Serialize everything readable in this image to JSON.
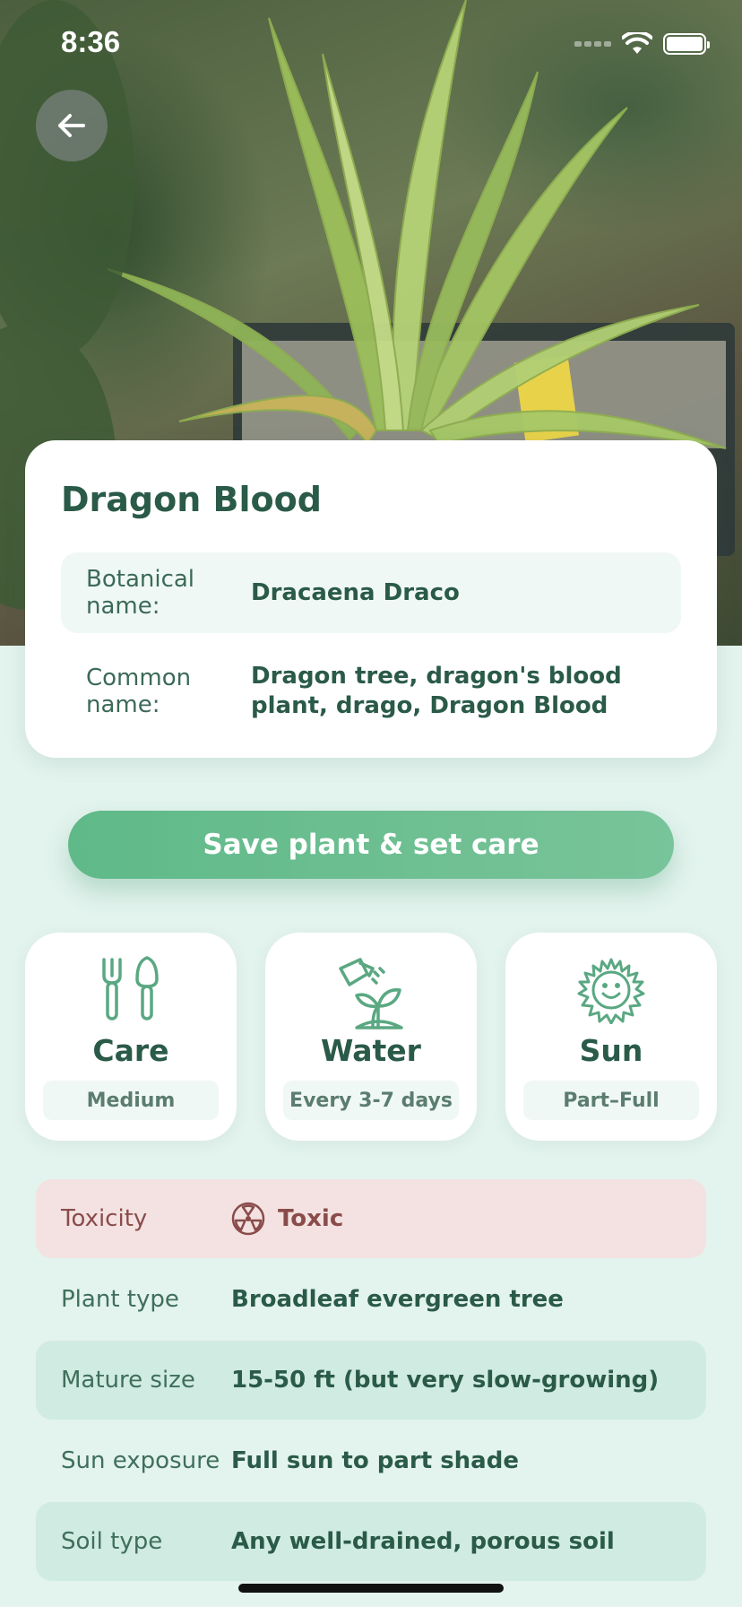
{
  "status_bar": {
    "time": "8:36"
  },
  "plant": {
    "title": "Dragon Blood",
    "botanical_label": "Botanical name:",
    "botanical_value": "Dracaena Draco",
    "common_label": "Common name:",
    "common_value": "Dragon tree, dragon's blood plant, drago, Dragon Blood"
  },
  "actions": {
    "save_label": "Save plant & set care"
  },
  "care_cards": [
    {
      "title": "Care",
      "value": "Medium",
      "icon": "garden-tools-icon"
    },
    {
      "title": "Water",
      "value": "Every 3-7 days",
      "icon": "watering-can-icon"
    },
    {
      "title": "Sun",
      "value": "Part–Full",
      "icon": "sun-icon"
    }
  ],
  "details": [
    {
      "label": "Toxicity",
      "value": "Toxic",
      "icon": "toxic-icon"
    },
    {
      "label": "Plant type",
      "value": "Broadleaf evergreen tree"
    },
    {
      "label": "Mature size",
      "value": "15-50 ft (but very slow-growing)"
    },
    {
      "label": "Sun exposure",
      "value": "Full sun to part shade"
    },
    {
      "label": "Soil type",
      "value": "Any well-drained, porous soil"
    }
  ],
  "colors": {
    "accent": "#5fb988",
    "background": "#e3f3ee",
    "title": "#2a5a48",
    "toxic_bg": "#f3e2e1",
    "toxic_text": "#8a4b4b"
  }
}
